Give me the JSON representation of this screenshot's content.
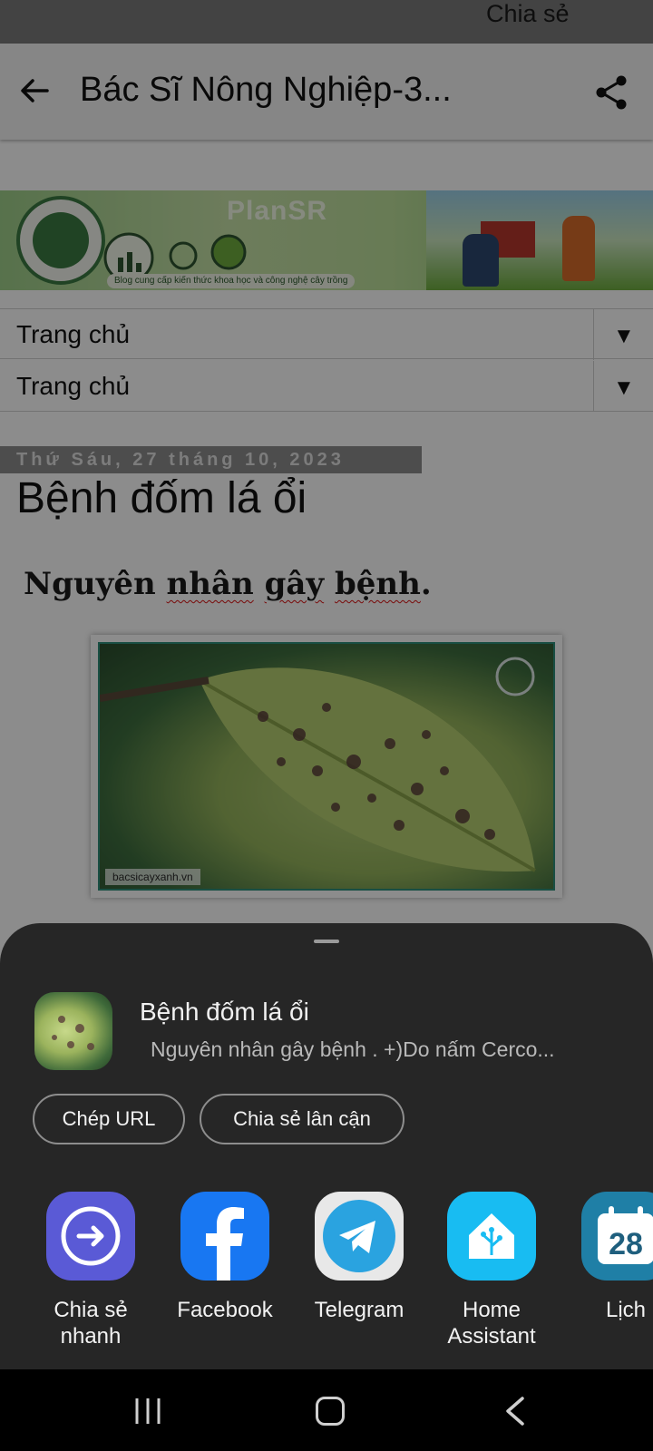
{
  "browser": {
    "title": "Bác Sĩ Nông Nghiệp-3...",
    "share_tooltip": "Chia sẻ"
  },
  "banner": {
    "brand": "PlanSR",
    "tagline": "Blog cung cấp kiến thức khoa học và công nghệ cây trồng",
    "logo_icon": "plantsr-logo"
  },
  "menus": [
    {
      "label": "Trang chủ",
      "caret": "▼"
    },
    {
      "label": "Trang chủ",
      "caret": "▼"
    }
  ],
  "post": {
    "date": "Thứ Sáu, 27 tháng 10, 2023",
    "title": "Bệnh đốm lá ổi",
    "subtitle_words": [
      "Nguyên",
      "nhân",
      "gây",
      "bệnh",
      "."
    ],
    "image_caption": "bacsicayxanh.vn"
  },
  "share_sheet": {
    "title": "Bệnh đốm lá ổi",
    "description": "Nguyên nhân  gây  bệnh .   +)Do nấm  Cerco...",
    "chips": [
      "Chép URL",
      "Chia sẻ lân cận"
    ],
    "apps": [
      {
        "label": "Chia sẻ nhanh",
        "icon": "quick-share-icon",
        "color": "#5a5ad6"
      },
      {
        "label": "Facebook",
        "icon": "facebook-icon",
        "color": "#1877f2"
      },
      {
        "label": "Telegram",
        "icon": "telegram-icon",
        "color": "#2aa3e0"
      },
      {
        "label": "Home Assistant",
        "icon": "home-assistant-icon",
        "color": "#18bcf2"
      },
      {
        "label": "Lịch",
        "icon": "calendar-icon",
        "color": "#1f7fa6",
        "calendar_day": "28"
      }
    ]
  }
}
